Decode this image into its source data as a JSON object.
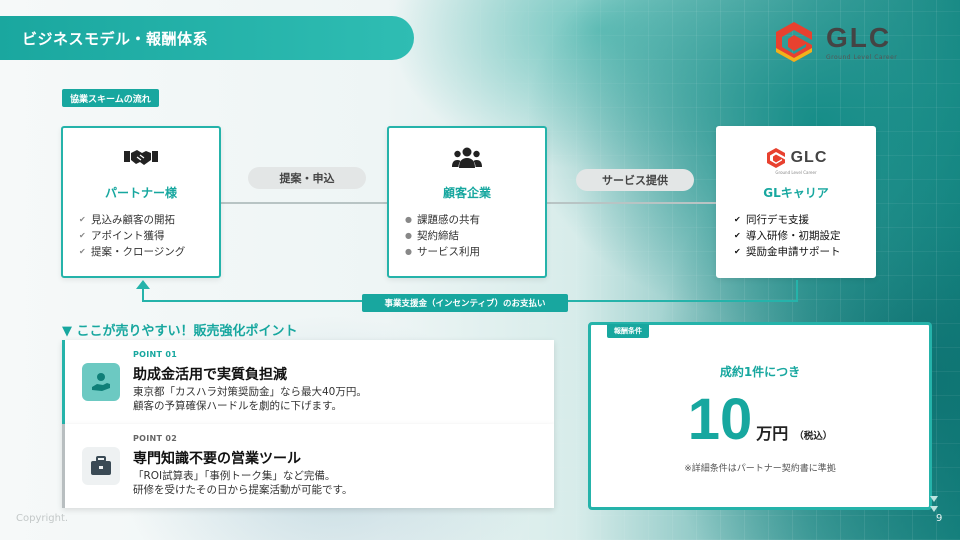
{
  "slide": {
    "title": "ビジネスモデル・報酬体系",
    "copyright": "Copyright.",
    "page_number": "9"
  },
  "logo": {
    "text": "GLC",
    "tagline": "Ground Level Career",
    "colors": {
      "red": "#e8412f",
      "yellow": "#f2b21b",
      "gray": "#444444"
    }
  },
  "flow": {
    "section_label": "協業スキームの流れ",
    "arrow_labels": {
      "proposal": "提案・申込",
      "service": "サービス提供"
    },
    "partner": {
      "icon": "handshake-icon",
      "title": "パートナー様",
      "items": [
        "見込み顧客の開拓",
        "アポイント獲得",
        "提案・クロージング"
      ]
    },
    "client": {
      "icon": "users-icon",
      "title": "顧客企業",
      "items": [
        "課題感の共有",
        "契約締結",
        "サービス利用"
      ]
    },
    "glc": {
      "logo_text": "GLC",
      "logo_tagline": "Ground Level Career",
      "title": "GLキャリア",
      "items": [
        "同行デモ支援",
        "導入研修・初期設定",
        "奨励金申請サポート"
      ]
    },
    "payment_label": "事業支援金（インセンティブ）のお支払い"
  },
  "selling_points": {
    "heading": "▼ ここが売りやすい！販売強化ポイント",
    "points": [
      {
        "no": "POINT 01",
        "icon": "hand-coin-icon",
        "title": "助成金活用で実質負担減",
        "desc": [
          "東京都「カスハラ対策奨励金」なら最大40万円。",
          "顧客の予算確保ハードルを劇的に下げます。"
        ]
      },
      {
        "no": "POINT 02",
        "icon": "briefcase-icon",
        "title": "専門知識不要の営業ツール",
        "desc": [
          "「ROI試算表」「事例トーク集」など完備。",
          "研修を受けたその日から提案活動が可能です。"
        ]
      }
    ]
  },
  "fee": {
    "tag": "報酬条件",
    "unit_label": "成約1件につき",
    "amount": "10",
    "unit": "万円",
    "tax_note": "（税込）",
    "footnote": "※詳細条件はパートナー契約書に準拠"
  },
  "colors": {
    "accent": "#17a79f",
    "border": "#25b3aa",
    "pill": "#e3e6e6"
  }
}
